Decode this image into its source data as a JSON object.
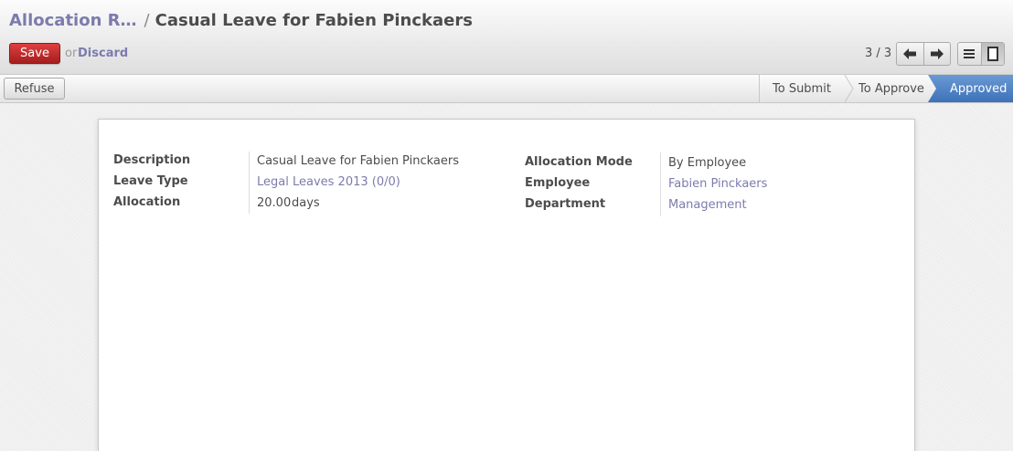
{
  "breadcrumb": {
    "parent": "Allocation R…",
    "separator": "/",
    "current": "Casual Leave for Fabien Pinckaers"
  },
  "toolbar": {
    "save_label": "Save",
    "or_label": "or",
    "discard_label": "Discard",
    "pager_text": "3 / 3"
  },
  "statusbar": {
    "refuse_label": "Refuse",
    "stages": [
      "To Submit",
      "To Approve",
      "Approved"
    ],
    "active_stage": "Approved"
  },
  "form": {
    "left": {
      "description_label": "Description",
      "description_value": "Casual Leave for Fabien Pinckaers",
      "leave_type_label": "Leave Type",
      "leave_type_value": "Legal Leaves 2013 (0/0)",
      "allocation_label": "Allocation",
      "allocation_value": "20.00",
      "allocation_unit": "days"
    },
    "right": {
      "mode_label": "Allocation Mode",
      "mode_value": "By Employee",
      "employee_label": "Employee",
      "employee_value": "Fabien Pinckaers",
      "department_label": "Department",
      "department_value": "Management"
    }
  },
  "colors": {
    "accent": "#7c7bad",
    "save": "#c42d2d",
    "active_stage": "#4a7fc1"
  },
  "icons": [
    "arrow-left-icon",
    "arrow-right-icon",
    "list-view-icon",
    "form-view-icon"
  ]
}
